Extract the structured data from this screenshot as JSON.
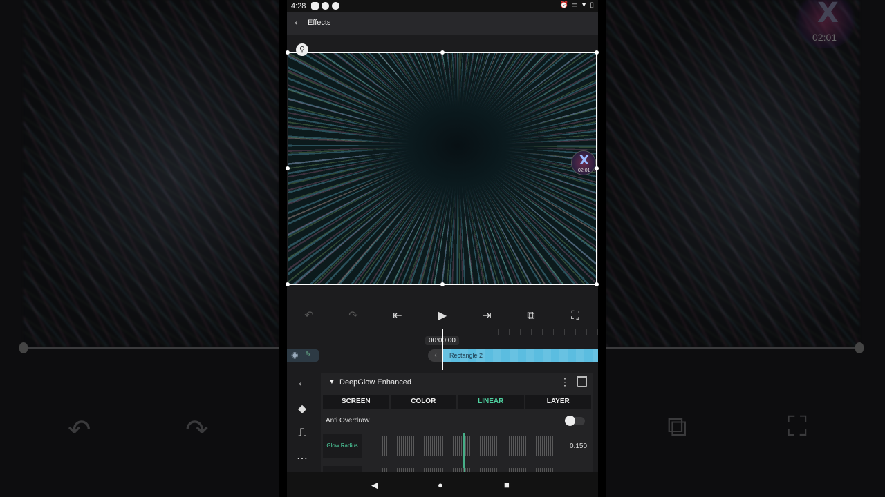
{
  "statusbar": {
    "time": "4:28",
    "left_icons": [
      "youtube-icon",
      "app-icon",
      "app-icon"
    ],
    "right_icons": [
      "alarm-icon",
      "cast-icon",
      "wifi-icon",
      "battery-icon"
    ]
  },
  "appbar": {
    "title": "Effects"
  },
  "watermark": {
    "label": "02:01"
  },
  "timeline": {
    "timecode": "00:00:00",
    "clip_label": "Rectangle 2"
  },
  "effect": {
    "name": "DeepGlow Enhanced",
    "tabs": [
      {
        "label": "SCREEN",
        "active": false
      },
      {
        "label": "COLOR",
        "active": false
      },
      {
        "label": "LINEAR",
        "active": true
      },
      {
        "label": "LAYER",
        "active": false
      }
    ],
    "anti_overdraw_label": "Anti Overdraw",
    "anti_overdraw_on": false,
    "glow_radius_label": "Glow Radius",
    "glow_radius_value": "0.150"
  },
  "colors": {
    "accent": "#4fd1a0",
    "clip": "#5bbde0",
    "background": "#1c1c1e"
  }
}
